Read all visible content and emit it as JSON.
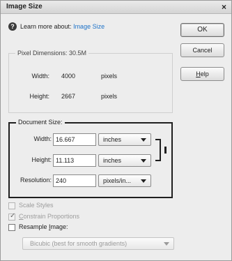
{
  "window": {
    "title": "Image Size",
    "close_glyph": "×"
  },
  "help": {
    "icon": "question-icon",
    "prefix": "Learn more about:",
    "link": "Image Size"
  },
  "buttons": {
    "ok": "OK",
    "cancel": "Cancel",
    "help_prefix": "",
    "help_underlined": "H",
    "help_rest": "elp"
  },
  "pixel_dimensions": {
    "legend": "Pixel Dimensions: 30.5M",
    "width_label": "Width:",
    "width_value": "4000",
    "width_unit": "pixels",
    "height_label": "Height:",
    "height_value": "2667",
    "height_unit": "pixels"
  },
  "document_size": {
    "legend": "Document Size:",
    "width_label": "Width:",
    "width_value": "16.667",
    "width_unit": "inches",
    "height_label": "Height:",
    "height_value": "11.113",
    "height_unit": "inches",
    "resolution_label": "Resolution:",
    "resolution_value": "240",
    "resolution_unit": "pixels/in..."
  },
  "options": {
    "scale_styles": {
      "label": "Scale Styles",
      "checked": true,
      "enabled": false
    },
    "constrain": {
      "label_underlined": "C",
      "label_rest": "onstrain Proportions",
      "checked": true,
      "enabled": false
    },
    "resample": {
      "label_prefix": "Resample ",
      "label_underlined": "I",
      "label_rest": "mage:",
      "checked": false,
      "enabled": true
    },
    "resample_method": "Bicubic (best for smooth gradients)"
  }
}
